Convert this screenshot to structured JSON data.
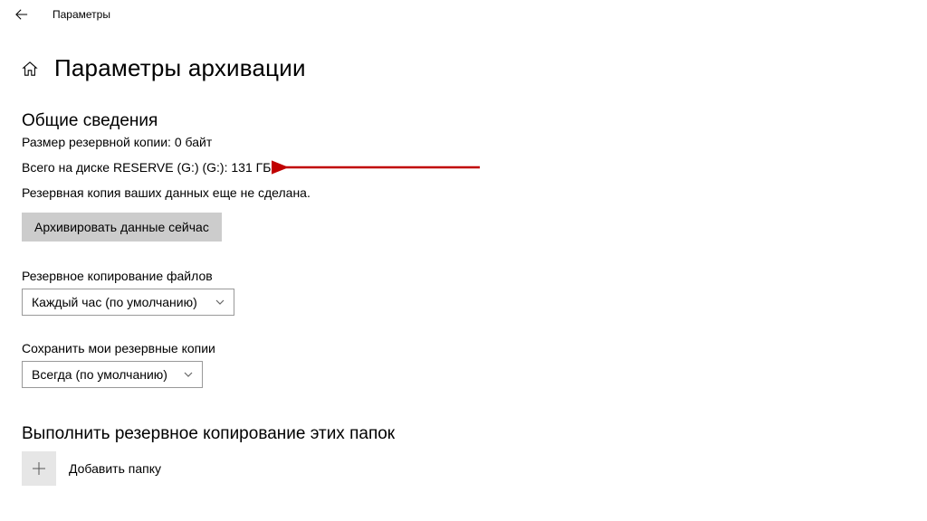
{
  "titlebar": {
    "title": "Параметры"
  },
  "header": {
    "page_title": "Параметры архивации"
  },
  "overview": {
    "heading": "Общие сведения",
    "backup_size": "Размер резервной копии: 0 байт",
    "disk_total": "Всего на диске RESERVE (G:) (G:): 131 ГБ",
    "not_backed_up": "Резервная копия ваших данных еще не сделана.",
    "backup_now_label": "Архивировать данные сейчас"
  },
  "frequency": {
    "label": "Резервное копирование файлов",
    "selected": "Каждый час (по умолчанию)"
  },
  "retention": {
    "label": "Сохранить мои резервные копии",
    "selected": "Всегда (по умолчанию)"
  },
  "folders": {
    "heading": "Выполнить резервное копирование этих папок",
    "add_label": "Добавить папку"
  }
}
